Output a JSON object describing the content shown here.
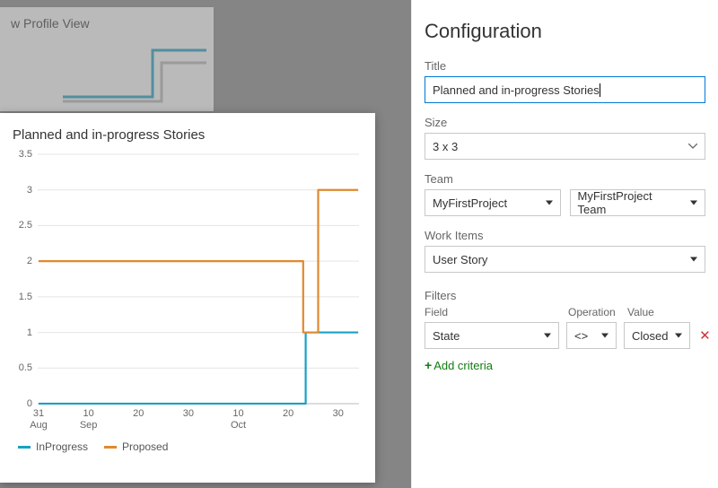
{
  "background": {
    "partial_title": "w Profile View"
  },
  "preview": {
    "title": "Planned and in-progress Stories"
  },
  "legend": {
    "series": [
      {
        "name": "InProgress",
        "color": "#1aa0c4"
      },
      {
        "name": "Proposed",
        "color": "#e08a2e"
      }
    ]
  },
  "chart_data": {
    "type": "line",
    "title": "Planned and in-progress Stories",
    "xlabel": "",
    "ylabel": "",
    "ylim": [
      0,
      3.5
    ],
    "y_ticks": [
      0,
      0.5,
      1,
      1.5,
      2,
      2.5,
      3,
      3.5
    ],
    "x_ticks": [
      "31\nAug",
      "10\nSep",
      "20",
      "30",
      "10\nOct",
      "20",
      "30"
    ],
    "x_index": [
      0,
      1,
      2,
      3,
      4,
      5,
      6
    ],
    "series": [
      {
        "name": "InProgress",
        "color": "#1aa0c4",
        "points": [
          {
            "x": 0.0,
            "y": 0
          },
          {
            "x": 5.35,
            "y": 0
          },
          {
            "x": 5.35,
            "y": 1
          },
          {
            "x": 6.4,
            "y": 1
          }
        ]
      },
      {
        "name": "Proposed",
        "color": "#e08a2e",
        "points": [
          {
            "x": 0.0,
            "y": 2
          },
          {
            "x": 5.3,
            "y": 2
          },
          {
            "x": 5.3,
            "y": 1
          },
          {
            "x": 5.6,
            "y": 1
          },
          {
            "x": 5.6,
            "y": 3
          },
          {
            "x": 6.4,
            "y": 3
          }
        ]
      }
    ]
  },
  "config": {
    "heading": "Configuration",
    "title_label": "Title",
    "title_value": "Planned and in-progress Stories",
    "size_label": "Size",
    "size_value": "3 x 3",
    "team_label": "Team",
    "team_project": "MyFirstProject",
    "team_team": "MyFirstProject Team",
    "workitems_label": "Work Items",
    "workitems_value": "User Story",
    "filters_label": "Filters",
    "filters_head": {
      "field": "Field",
      "operation": "Operation",
      "value": "Value"
    },
    "filter_row": {
      "field": "State",
      "operation": "<>",
      "value": "Closed"
    },
    "add_label": "Add criteria"
  }
}
